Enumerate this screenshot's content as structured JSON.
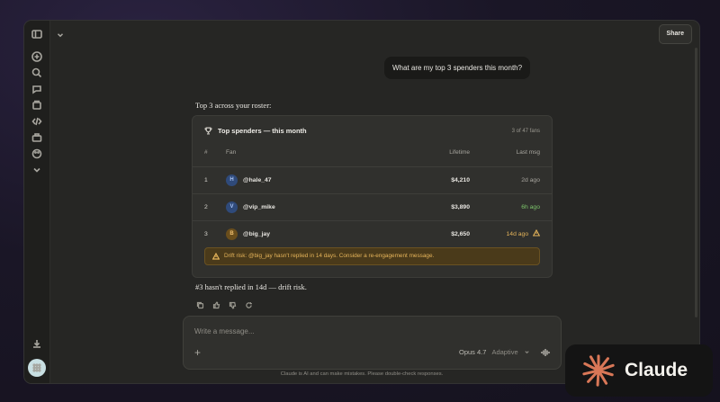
{
  "topbar": {
    "share_label": "Share"
  },
  "conversation": {
    "user_message": "What are my top 3 spenders this month?",
    "intro": "Top 3 across your roster:",
    "outro": "#3 hasn't replied in 14d — drift risk."
  },
  "card": {
    "title": "Top spenders — this month",
    "count": "3 of 47 fans",
    "headers": {
      "num": "#",
      "fan": "Fan",
      "lifetime": "Lifetime",
      "last": "Last msg"
    },
    "rows": [
      {
        "num": "1",
        "initial": "H",
        "handle": "@hale_47",
        "lifetime": "$4,210",
        "last": "2d ago",
        "badge_color": "#2f4a7a",
        "badge_text": "#a9c4f5",
        "last_color": "#a8a69f"
      },
      {
        "num": "2",
        "initial": "V",
        "handle": "@vip_mike",
        "lifetime": "$3,890",
        "last": "6h ago",
        "badge_color": "#2f4a7a",
        "badge_text": "#a9c4f5",
        "last_color": "#7cc46a"
      },
      {
        "num": "3",
        "initial": "B",
        "handle": "@big_jay",
        "lifetime": "$2,650",
        "last": "14d ago",
        "badge_color": "#6a4e1c",
        "badge_text": "#f0c070",
        "last_color": "#e5b45a"
      }
    ],
    "warning": "Drift risk: @big_jay hasn't replied in 14 days. Consider a re-engagement message."
  },
  "composer": {
    "placeholder": "Write a message...",
    "model": "Opus 4.7",
    "mode": "Adaptive"
  },
  "disclaimer": "Claude is AI and can make mistakes. Please double-check responses.",
  "brand": {
    "name": "Claude",
    "accent": "#d97757"
  }
}
